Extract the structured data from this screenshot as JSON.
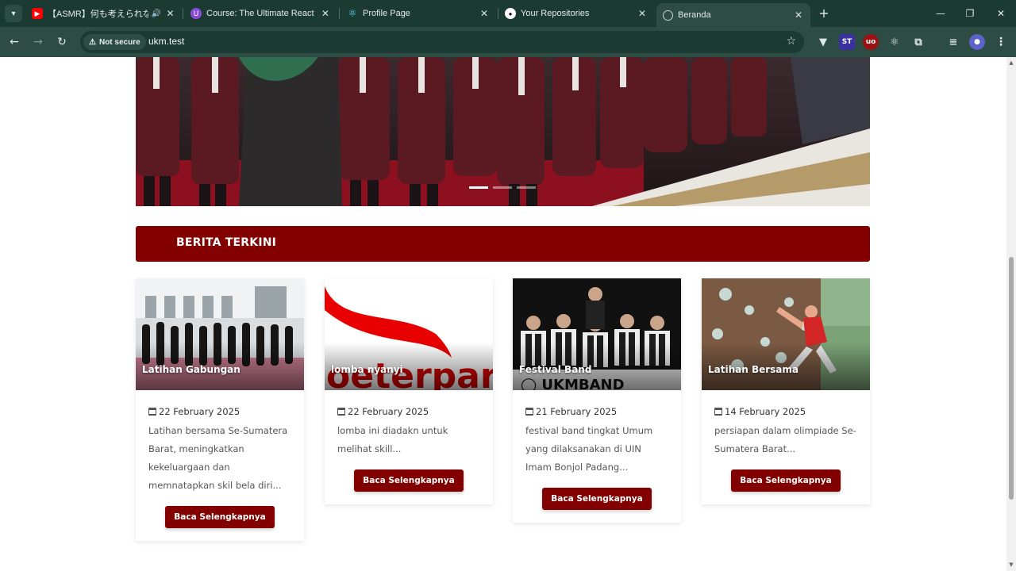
{
  "browser": {
    "tabs": [
      {
        "title": "【ASMR】何も考えられなくなる",
        "favicon": "youtube-icon",
        "color": "#ff0000",
        "audio": true,
        "active": false
      },
      {
        "title": "Course: The Ultimate React Cou",
        "favicon": "course-icon",
        "color": "#8a4bd6",
        "active": false
      },
      {
        "title": "Profile Page",
        "favicon": "react-icon",
        "color": "#61dafb",
        "active": false
      },
      {
        "title": "Your Repositories",
        "favicon": "github-icon",
        "color": "#ffffff",
        "active": false
      },
      {
        "title": "Beranda",
        "favicon": "globe-icon",
        "color": "#c7d3cf",
        "active": true
      }
    ],
    "address": {
      "security_label": "Not secure",
      "url": "ukm.test"
    }
  },
  "colors": {
    "brand": "#820000",
    "chrome_dark": "#1b3a32",
    "chrome": "#2d4c44"
  },
  "carousel": {
    "slide_count": 3,
    "active_index": 0
  },
  "section": {
    "title": "BERITA TERKINI"
  },
  "news": [
    {
      "title": "Latihan Gabungan",
      "date": "22 February 2025",
      "excerpt": "Latihan bersama Se-Sumatera Barat, meningkatkan kekeluargaan dan memnatapkan skil bela diri...",
      "button": "Baca Selengkapnya"
    },
    {
      "title": "lomba nyanyi",
      "date": "22 February 2025",
      "excerpt": "lomba ini diadakn untuk melihat skill...",
      "button": "Baca Selengkapnya"
    },
    {
      "title": "Festival Band",
      "date": "21 February 2025",
      "excerpt": "festival band tingkat Umum yang dilaksanakan di UIN Imam Bonjol Padang...",
      "button": "Baca Selengkapnya"
    },
    {
      "title": "Latihan Bersama",
      "date": "14 February 2025",
      "excerpt": "persiapan dalam olimpiade Se-Sumatera Barat...",
      "button": "Baca Selengkapnya"
    }
  ]
}
